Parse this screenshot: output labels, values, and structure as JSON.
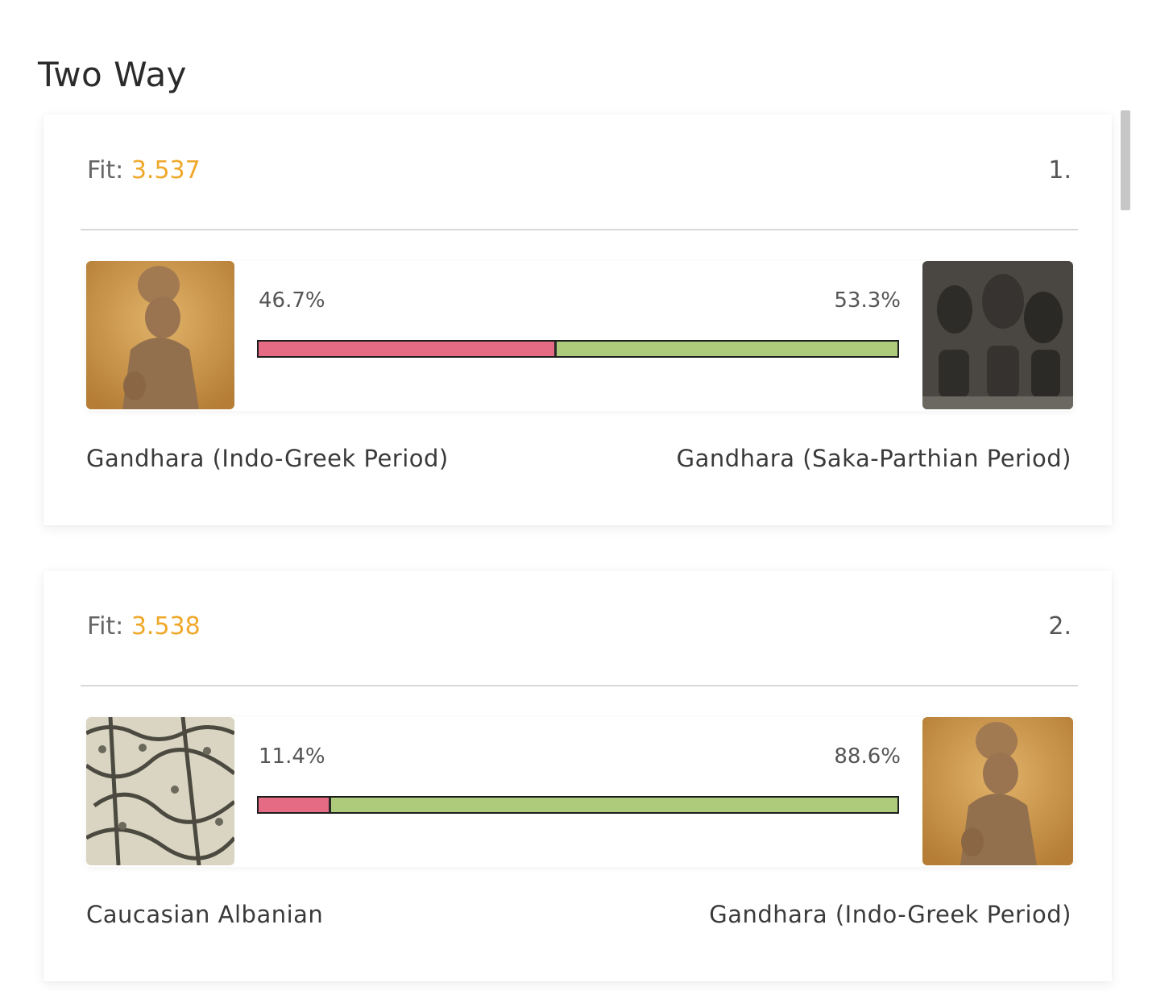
{
  "page": {
    "title": "Two Way"
  },
  "colors": {
    "fit": "#f0a82a",
    "source_a_bar": "#e56b84",
    "source_b_bar": "#aecb7c"
  },
  "results": [
    {
      "fit_label": "Fit:",
      "fit_value": "3.537",
      "rank": "1.",
      "left": {
        "percent_text": "46.7%",
        "percent": 46.7,
        "name": "Gandhara (Indo-Greek Period)",
        "image": "golden-buddha-statue-thumbnail"
      },
      "right": {
        "percent_text": "53.3%",
        "percent": 53.3,
        "name": "Gandhara (Saka-Parthian Period)",
        "image": "dark-stone-relief-thumbnail"
      }
    },
    {
      "fit_label": "Fit:",
      "fit_value": "3.538",
      "rank": "2.",
      "left": {
        "percent_text": "11.4%",
        "percent": 11.4,
        "name": "Caucasian Albanian",
        "image": "ornamental-stone-carving-thumbnail"
      },
      "right": {
        "percent_text": "88.6%",
        "percent": 88.6,
        "name": "Gandhara (Indo-Greek Period)",
        "image": "golden-buddha-statue-thumbnail"
      }
    }
  ]
}
